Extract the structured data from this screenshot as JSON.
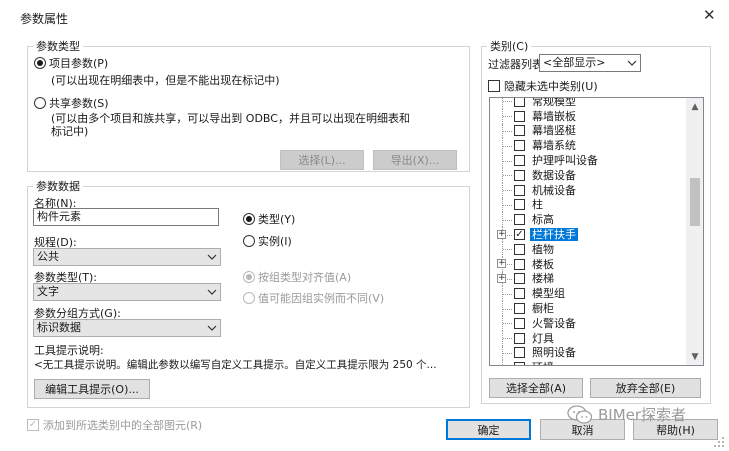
{
  "window": {
    "title": "参数属性",
    "close_glyph": "✕"
  },
  "param_type": {
    "legend": "参数类型",
    "project_label": "项目参数(P)",
    "project_desc": "(可以出现在明细表中，但是不能出现在标记中)",
    "shared_label": "共享参数(S)",
    "shared_desc_1": "(可以由多个项目和族共享，可以导出到 ODBC，并且可以出现在明细表和",
    "shared_desc_2": "标记中)",
    "select_button": "选择(L)...",
    "export_button": "导出(X)..."
  },
  "param_data": {
    "legend": "参数数据",
    "name_label": "名称(N):",
    "name_value": "构件元素",
    "type_radio": "类型(Y)",
    "instance_radio": "实例(I)",
    "discipline_label": "规程(D):",
    "discipline_value": "公共",
    "param_type_label": "参数类型(T):",
    "param_type_value": "文字",
    "align_type_radio": "按组类型对齐值(A)",
    "vary_instance_radio": "值可能因组实例而不同(V)",
    "group_label": "参数分组方式(G):",
    "group_value": "标识数据",
    "tooltip_label": "工具提示说明:",
    "tooltip_text": "<无工具提示说明。编辑此参数以编写自定义工具提示。自定义工具提示限为 250 个...",
    "edit_tooltip_button": "编辑工具提示(O)..."
  },
  "category": {
    "legend": "类别(C)",
    "filter_label": "过滤器列表",
    "filter_value": "<全部显示>",
    "hide_unchecked_label": "隐藏未选中类别(U)",
    "items": [
      {
        "label": "常规模型",
        "checked": false,
        "expandable": false,
        "selected": false
      },
      {
        "label": "幕墙嵌板",
        "checked": false,
        "expandable": false,
        "selected": false
      },
      {
        "label": "幕墙竖梃",
        "checked": false,
        "expandable": false,
        "selected": false
      },
      {
        "label": "幕墙系统",
        "checked": false,
        "expandable": false,
        "selected": false
      },
      {
        "label": "护理呼叫设备",
        "checked": false,
        "expandable": false,
        "selected": false
      },
      {
        "label": "数据设备",
        "checked": false,
        "expandable": false,
        "selected": false
      },
      {
        "label": "机械设备",
        "checked": false,
        "expandable": false,
        "selected": false
      },
      {
        "label": "柱",
        "checked": false,
        "expandable": false,
        "selected": false
      },
      {
        "label": "标高",
        "checked": false,
        "expandable": false,
        "selected": false
      },
      {
        "label": "栏杆扶手",
        "checked": true,
        "expandable": true,
        "selected": true
      },
      {
        "label": "植物",
        "checked": false,
        "expandable": false,
        "selected": false
      },
      {
        "label": "楼板",
        "checked": false,
        "expandable": true,
        "selected": false
      },
      {
        "label": "楼梯",
        "checked": false,
        "expandable": true,
        "selected": false
      },
      {
        "label": "模型组",
        "checked": false,
        "expandable": false,
        "selected": false
      },
      {
        "label": "橱柜",
        "checked": false,
        "expandable": false,
        "selected": false
      },
      {
        "label": "火警设备",
        "checked": false,
        "expandable": false,
        "selected": false
      },
      {
        "label": "灯具",
        "checked": false,
        "expandable": false,
        "selected": false
      },
      {
        "label": "照明设备",
        "checked": false,
        "expandable": false,
        "selected": false
      },
      {
        "label": "环境",
        "checked": false,
        "expandable": false,
        "selected": false
      }
    ],
    "select_all_button": "选择全部(A)",
    "clear_all_button": "放弃全部(E)"
  },
  "footer": {
    "add_to_all_label": "添加到所选类别中的全部图元(R)",
    "ok_button": "确定",
    "cancel_button": "取消",
    "help_button": "帮助(H)"
  },
  "watermark": {
    "text": "BIMer探索者"
  },
  "icons": {
    "close": "close-icon",
    "dropdown": "chevron-down-icon",
    "checkmark": "check-icon",
    "expand": "plus-box-icon",
    "scroll_up": "scroll-up-icon",
    "scroll_down": "scroll-down-icon",
    "watermark": "wechat-icon",
    "grip": "resize-grip-icon"
  },
  "colors": {
    "selection": "#0078d7",
    "disabled_text": "#9a9a9a",
    "button_face": "#e1e1e1"
  }
}
